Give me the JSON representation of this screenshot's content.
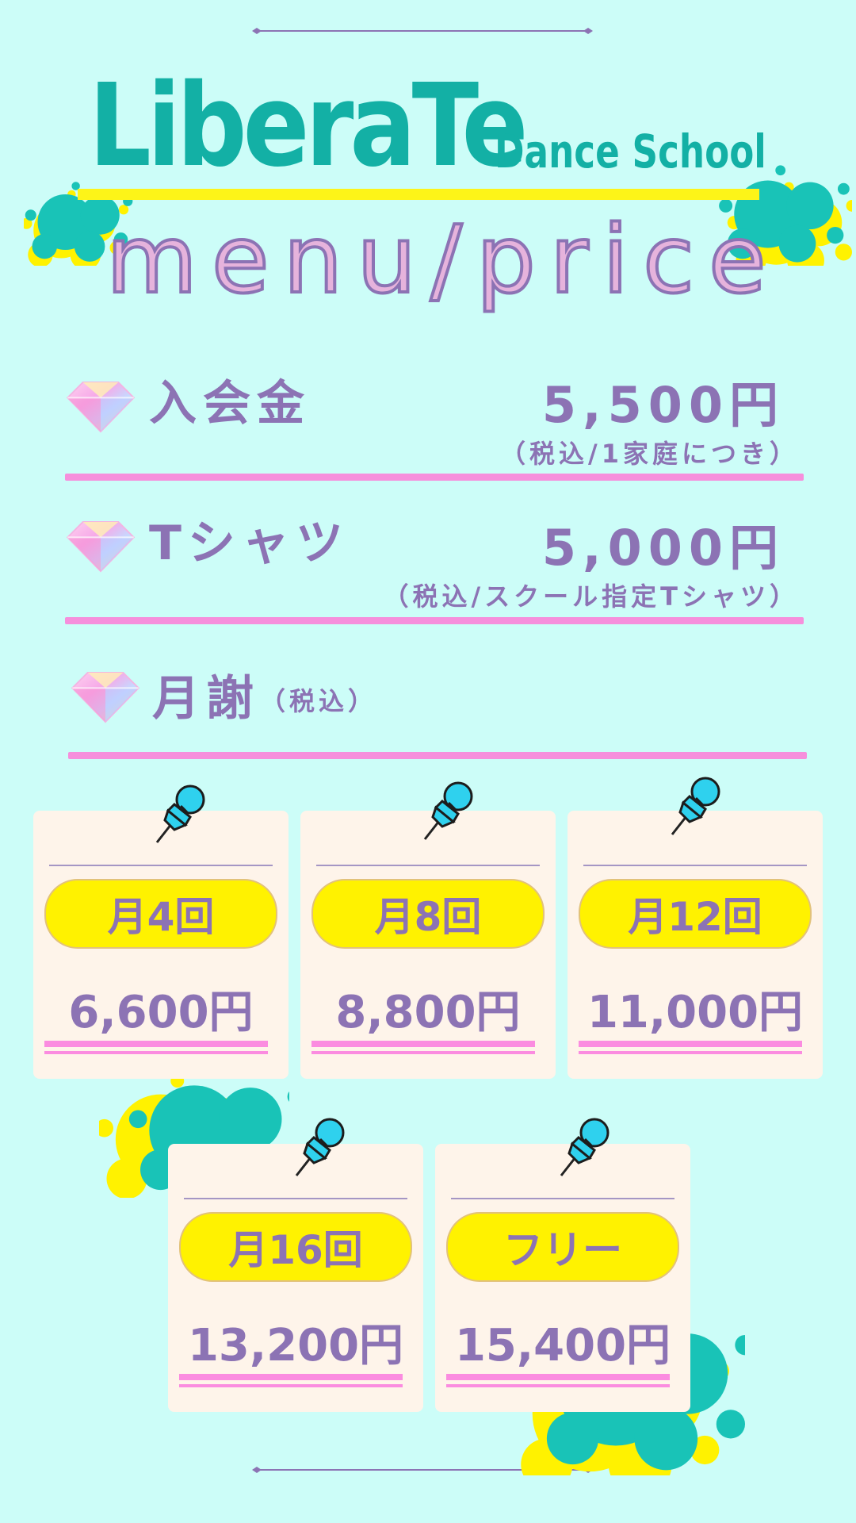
{
  "header": {
    "brand": "LiberaTe",
    "sub_brand": "Dance School",
    "title": "menu/price"
  },
  "fees": [
    {
      "label": "入会金",
      "price": "5,500円",
      "note": "（税込/1家庭につき）"
    },
    {
      "label": "Tシャツ",
      "price": "5,000円",
      "note": "（税込/スクール指定Tシャツ）"
    }
  ],
  "monthly": {
    "label": "月謝",
    "note": "（税込）"
  },
  "plans": [
    {
      "name": "月4回",
      "price": "6,600円"
    },
    {
      "name": "月8回",
      "price": "8,800円"
    },
    {
      "name": "月12回",
      "price": "11,000円"
    },
    {
      "name": "月16回",
      "price": "13,200円"
    },
    {
      "name": "フリー",
      "price": "15,400円"
    }
  ],
  "colors": {
    "background": "#ccfdf8",
    "brand_teal": "#13b0a5",
    "accent_yellow": "#fff200",
    "text_purple": "#8c73b4",
    "rule_pink": "#f68fdc",
    "card_cream": "#fef4ea",
    "pin_blue": "#2fd1ee"
  },
  "icons": [
    "diamond-icon",
    "pushpin-icon",
    "paint-splatter"
  ]
}
